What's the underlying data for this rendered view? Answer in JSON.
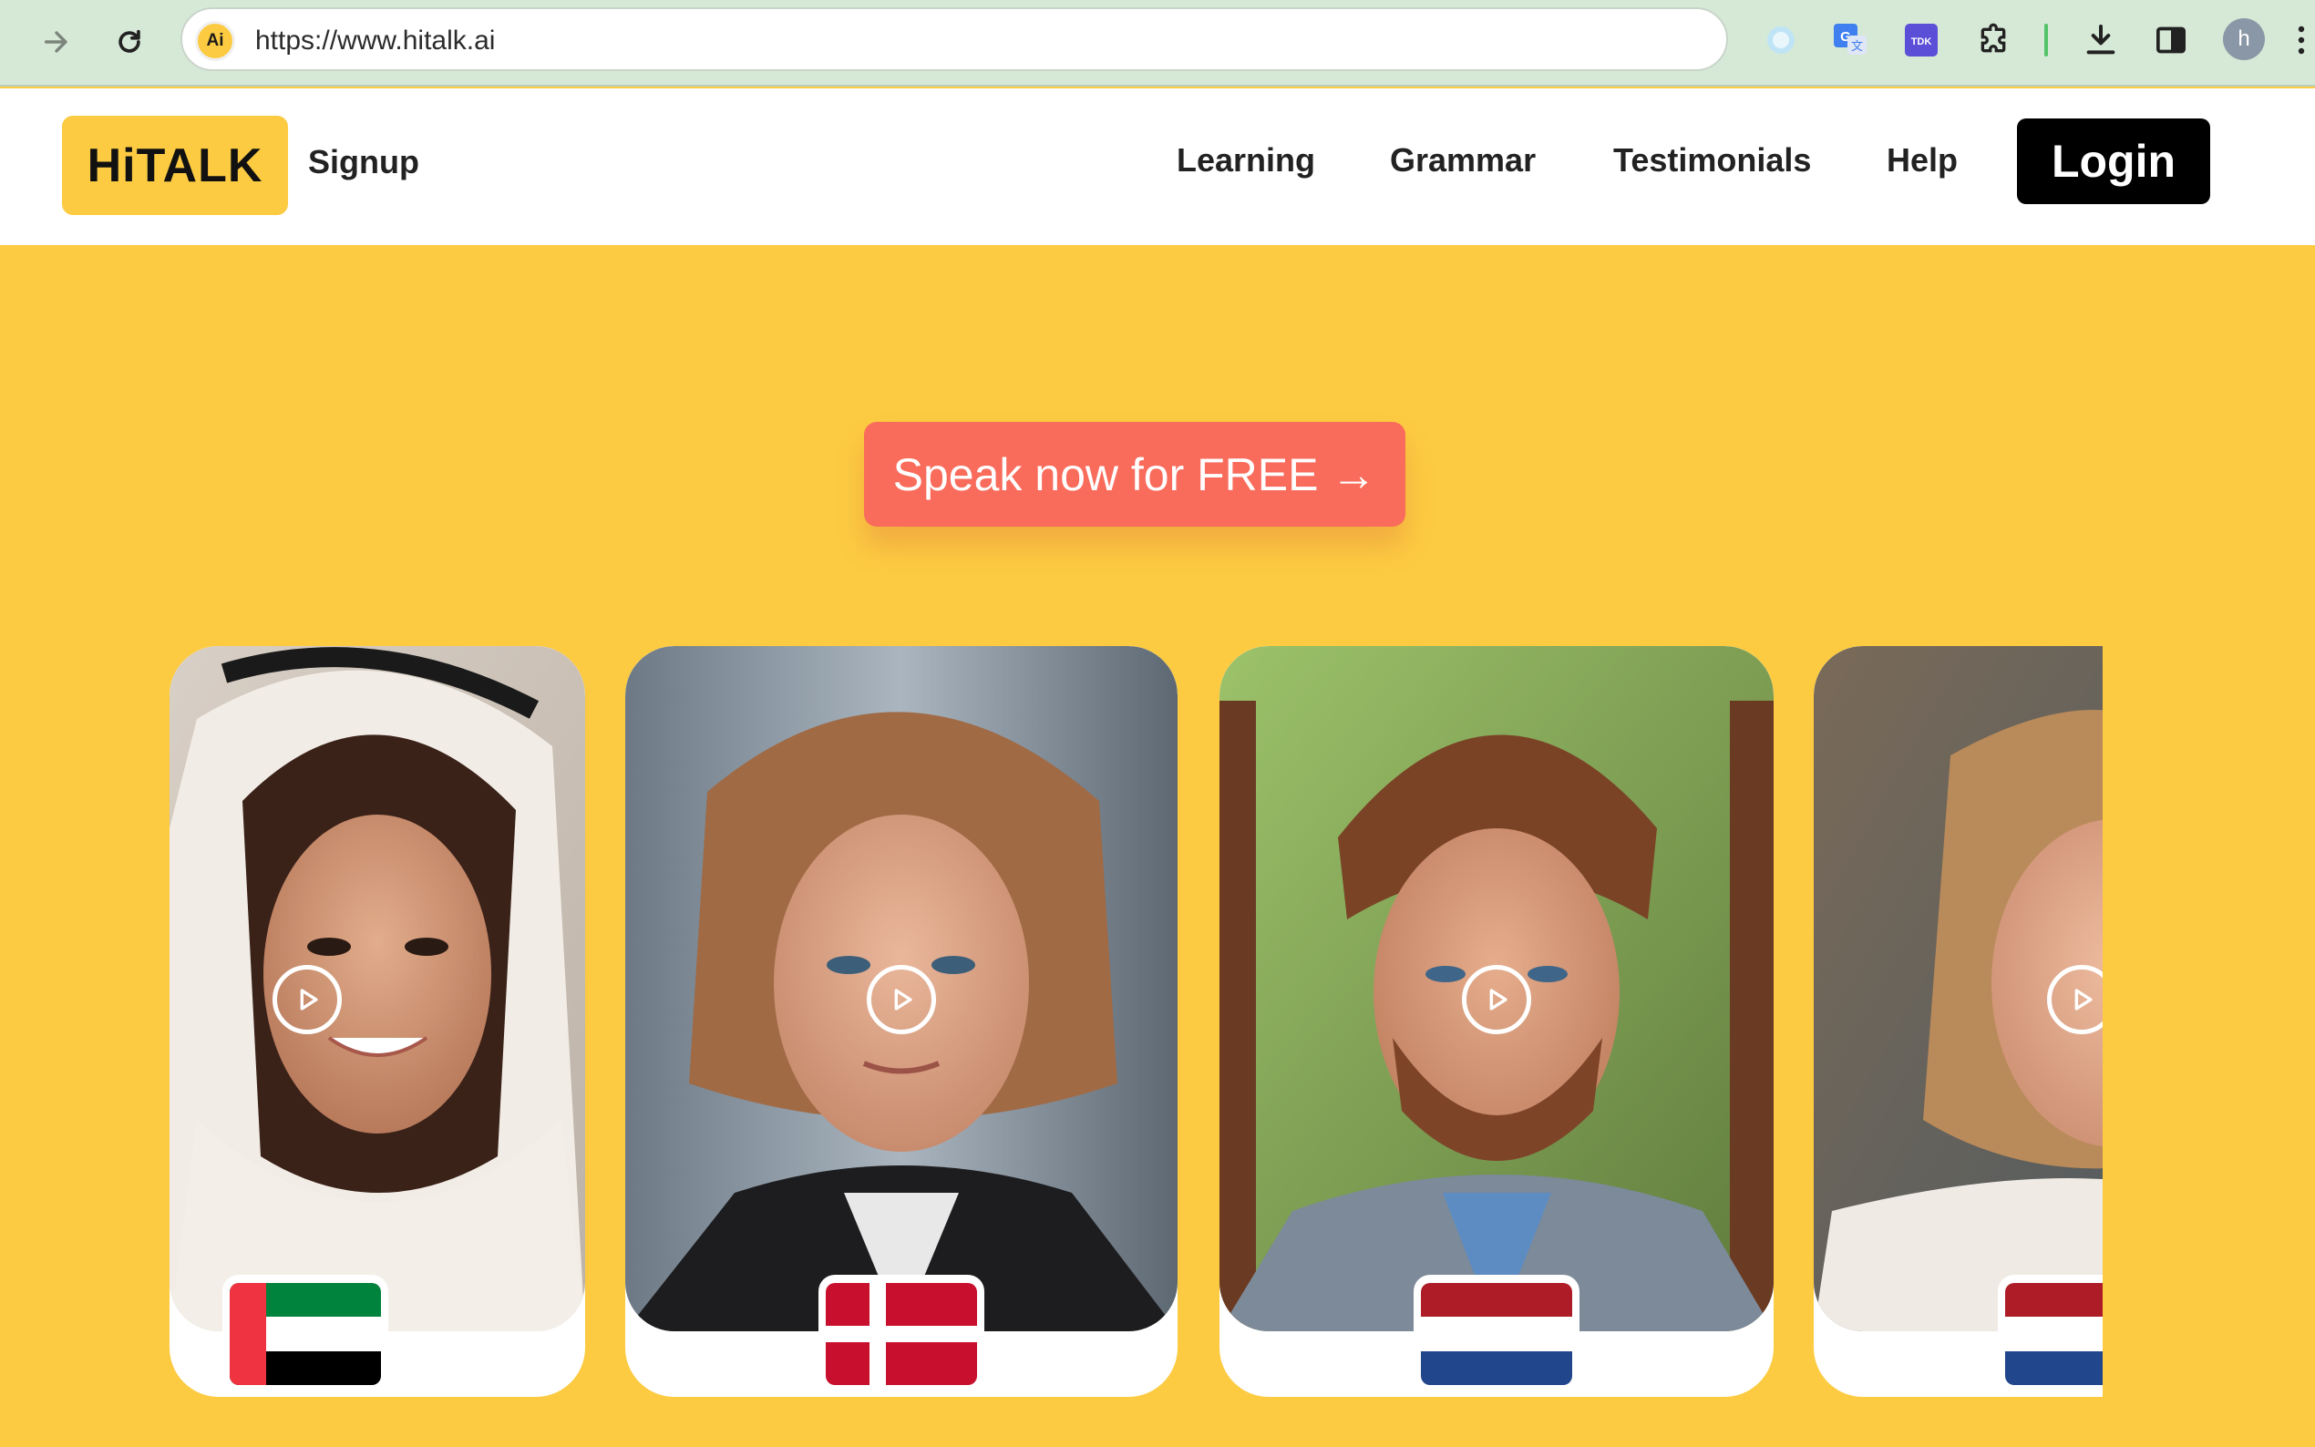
{
  "browser": {
    "url": "https://www.hitalk.ai",
    "site_badge": "Ai",
    "profile_initial": "h",
    "extensions": [
      "circle-extension-icon",
      "google-translate-icon",
      "tdk-extension-icon",
      "puzzle-extensions-icon"
    ],
    "tdk_label": "TDK"
  },
  "header": {
    "logo": "HiTALK",
    "signup": "Signup",
    "nav": [
      "Learning",
      "Grammar",
      "Testimonials",
      "Help"
    ],
    "login": "Login"
  },
  "hero": {
    "cta": "Speak now for FREE →"
  },
  "cards": [
    {
      "portrait": "woman-in-white-headscarf",
      "flag": "united-arab-emirates"
    },
    {
      "portrait": "woman-with-short-blonde-hair",
      "flag": "denmark"
    },
    {
      "portrait": "bearded-man-in-blazer",
      "flag": "netherlands"
    },
    {
      "portrait": "smiling-woman-partially-visible",
      "flag": "netherlands"
    }
  ],
  "colors": {
    "brand_yellow": "#fccb42",
    "cta_coral": "#f96b5b",
    "login_black": "#000000",
    "browser_green": "#d6e9d7"
  }
}
